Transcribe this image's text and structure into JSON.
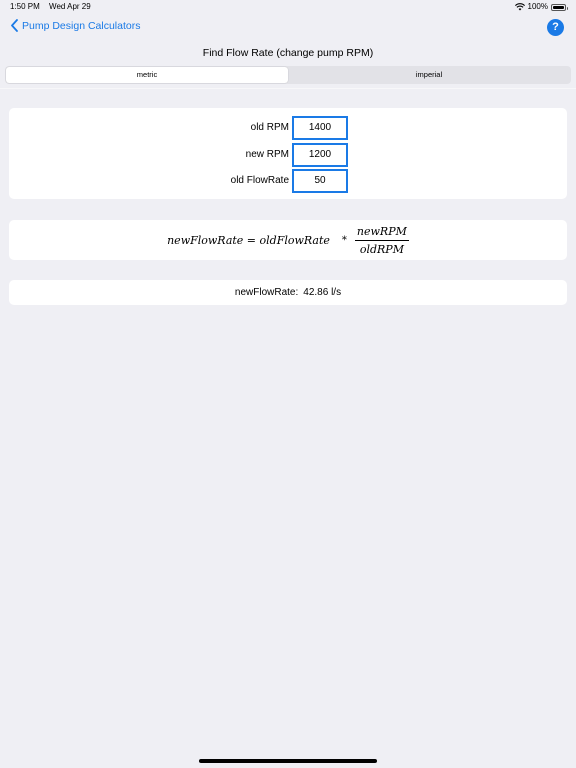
{
  "status": {
    "time": "1:50 PM",
    "date": "Wed Apr 29",
    "battery": "100%"
  },
  "nav": {
    "back_label": "Pump Design Calculators",
    "help_label": "?"
  },
  "page": {
    "title": "Find Flow Rate (change pump RPM)"
  },
  "units": {
    "options": [
      "metric",
      "imperial"
    ],
    "selected": "metric"
  },
  "inputs": [
    {
      "label": "old RPM",
      "value": "1400"
    },
    {
      "label": "new RPM",
      "value": "1200"
    },
    {
      "label": "old FlowRate",
      "value": "50"
    }
  ],
  "formula": {
    "lhs": "newFlowRate = oldFlowRate",
    "operator": "*",
    "numerator": "newRPM",
    "denominator": "oldRPM"
  },
  "result": {
    "label": "newFlowRate:",
    "value": "42.86 l/s"
  },
  "colors": {
    "accent": "#1a7ae6",
    "background": "#efeff4",
    "card": "#ffffff"
  }
}
